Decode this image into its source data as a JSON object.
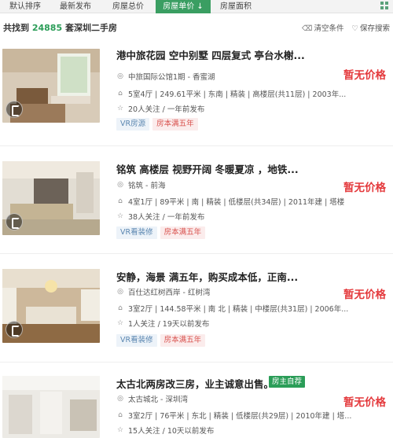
{
  "sort_tabs": [
    "默认排序",
    "最新发布",
    "房屋总价",
    "房屋单价 ↓",
    "房屋面积"
  ],
  "summary": {
    "prefix": "共找到",
    "count": "24885",
    "suffix": "套深圳二手房",
    "clear_label": "清空条件",
    "save_label": "保存搜索"
  },
  "listings": [
    {
      "title": "港中旅花园 空中别墅 四层复式 亭台水榭...",
      "location": "中旅国际公馆1期 - 香蜜湖",
      "details": "5室4厅 | 249.61平米 | 东南 | 精装 | 高楼层(共11层) | 2003年...",
      "followers": "20人关注 / 一年前发布",
      "price": "暂无价格",
      "tags": [
        "VR房源",
        "房本满五年"
      ]
    },
    {
      "title": "铭筑 高楼层 视野开阔 冬暖夏凉 ，地铁...",
      "location": "铭筑 - 前海",
      "details": "4室1厅 | 89平米 | 南 | 精装 | 低楼层(共34层) | 2011年建 | 塔楼",
      "followers": "38人关注 / 一年前发布",
      "price": "暂无价格",
      "tags": [
        "VR看装修",
        "房本满五年"
      ]
    },
    {
      "title": "安静，海景 满五年，购买成本低，正南...",
      "location": "百仕达红树西岸 - 红树湾",
      "details": "3室2厅 | 144.58平米 | 南 北 | 精装 | 中楼层(共31层) | 2006年...",
      "followers": "1人关注 / 19天以前发布",
      "price": "暂无价格",
      "tags": [
        "VR看装修",
        "房本满五年"
      ]
    },
    {
      "title": "太古北两房改三房，业主诚意出售。",
      "owner_tag": "房主自荐",
      "location": "太古城北 - 深圳湾",
      "details": "3室2厅 | 76平米 | 东北 | 精装 | 低楼层(共29层) | 2010年建 | 塔...",
      "followers": "15人关注 / 10天以前发布",
      "price": "暂无价格",
      "tags": []
    }
  ],
  "icons": {
    "location": "map-pin-icon",
    "details": "house-icon",
    "followers": "star-icon",
    "clear": "broom-icon",
    "save": "heart-icon",
    "view_toggle": "grid-icon"
  },
  "colors": {
    "accent_green": "#3a9e62",
    "count_green": "#2b9d58",
    "price_red": "#e4393c",
    "vr_tag_blue": "#5a86b0",
    "tax_tag_red": "#d9534f"
  }
}
